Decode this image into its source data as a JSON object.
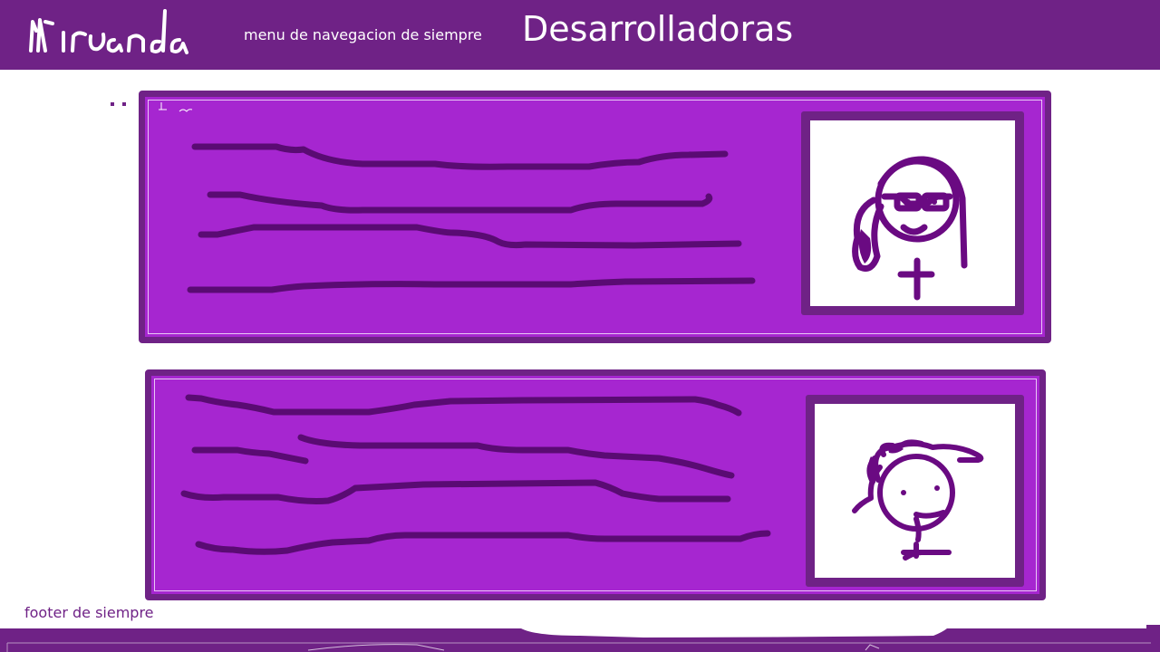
{
  "header": {
    "logo_text": "Miranda",
    "nav_text": "menu de navegacion de siempre",
    "page_title": "Desarrolladoras"
  },
  "footer": {
    "text": "footer de siempre"
  },
  "colors": {
    "brand_dark": "#6f2286",
    "card_fill": "#a626d0",
    "scribble": "#5a0b73",
    "background": "#ffffff"
  },
  "cards": [
    {
      "name": "developer-card-1",
      "avatar": "woman-with-glasses-avatar",
      "text_lines": 4
    },
    {
      "name": "developer-card-2",
      "avatar": "woman-with-curly-hair-avatar",
      "text_lines": 5
    }
  ]
}
